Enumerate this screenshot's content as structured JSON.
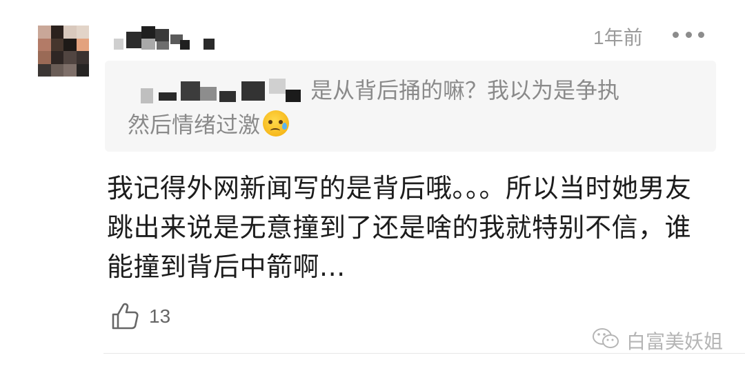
{
  "comment": {
    "time": "1年前",
    "more_icon": "more-dots-icon",
    "quote": {
      "line1_visible": "是从背后捅的嘛？我以为是争执",
      "line2": "然后情绪过激",
      "emoji": "crying-face-emoji"
    },
    "body": "我记得外网新闻写的是背后哦。。。所以当时她男友跳出来说是无意撞到了还是啥的我就特别不信，谁能撞到背后中箭啊...",
    "like_icon": "thumbs-up-icon",
    "like_count": "13"
  },
  "watermark": {
    "icon": "wechat-icon",
    "text": "白富美妖姐"
  },
  "colors": {
    "time": "#9a9a9a",
    "quote_bg": "#f6f6f6",
    "quote_text": "#8a8a8a",
    "body_text": "#1c1c1c",
    "watermark": "#b5b5b5"
  }
}
